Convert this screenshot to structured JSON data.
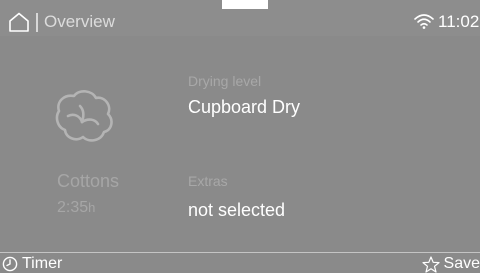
{
  "header": {
    "title": "Overview",
    "time": "11:02",
    "home_icon": "home-icon",
    "wifi_icon": "wifi-icon"
  },
  "program": {
    "icon": "cotton-boll-icon",
    "name": "Cottons",
    "duration": "2:35",
    "duration_unit": "h"
  },
  "drying_level": {
    "label": "Drying level",
    "value": "Cupboard Dry"
  },
  "extras": {
    "label": "Extras",
    "value": "not selected"
  },
  "footer": {
    "timer_label": "Timer",
    "timer_icon": "clock-icon",
    "save_label": "Save",
    "save_icon": "star-icon"
  },
  "colors": {
    "background": "#8a8a8a",
    "text_primary": "#ffffff",
    "text_secondary": "#a8a8a8"
  }
}
